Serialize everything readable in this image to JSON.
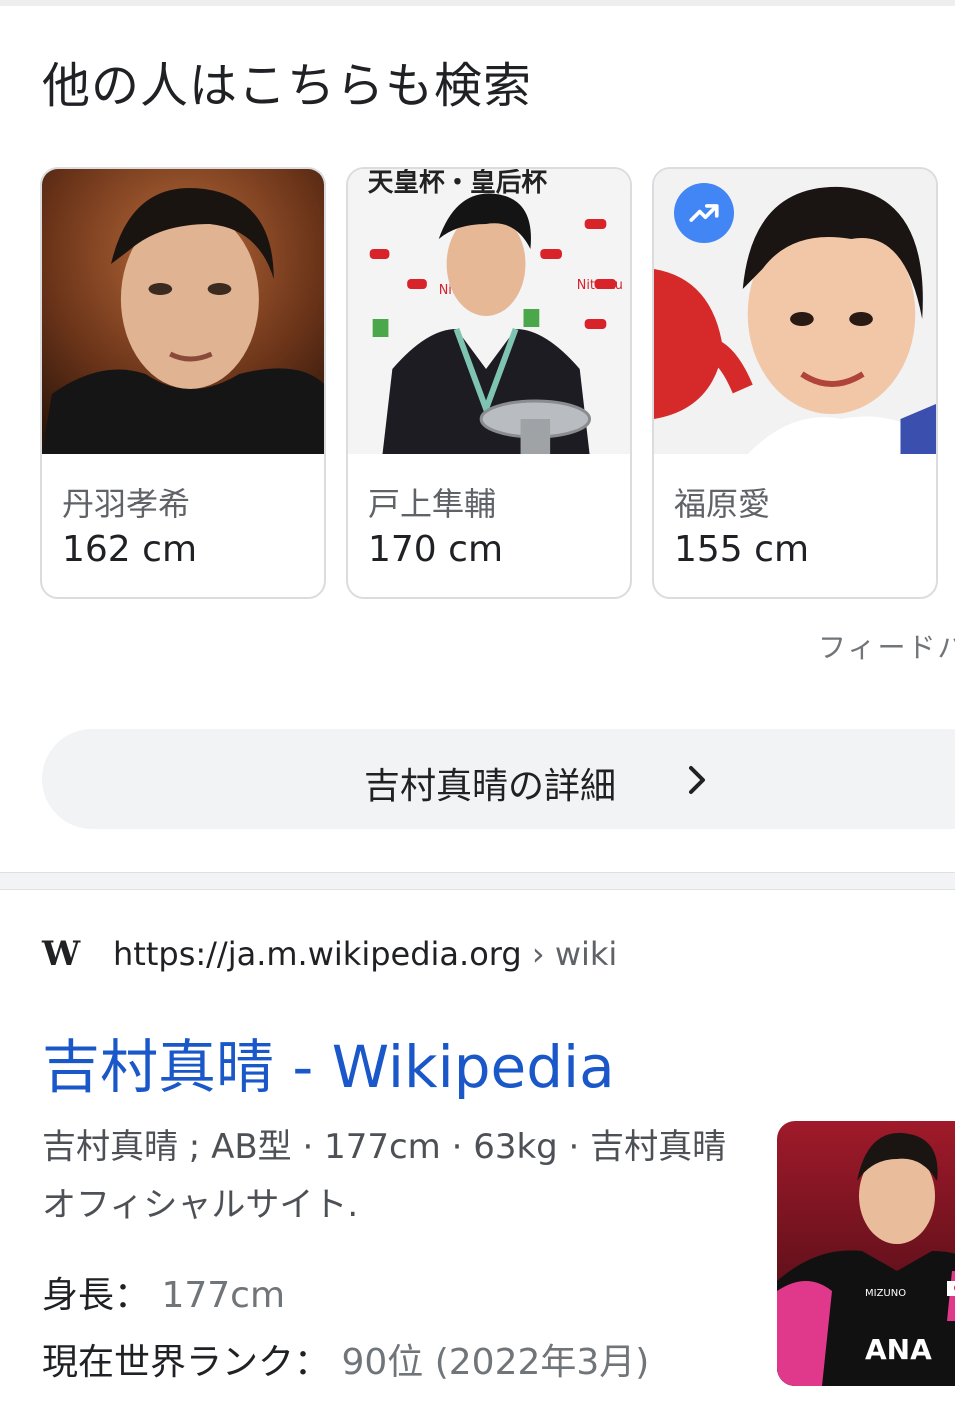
{
  "section": {
    "title": "他の人はこちらも検索"
  },
  "people": [
    {
      "name": "丹羽孝希",
      "height": "162 cm"
    },
    {
      "name": "戸上隼輔",
      "height": "170 cm"
    },
    {
      "name": "福原愛",
      "height": "155 cm"
    }
  ],
  "photo_text": {
    "banner": "天皇杯・皇后杯",
    "logo": "Nittaku",
    "sponsor": "ANA",
    "shirt_brand": "MIZUNO"
  },
  "feedback": {
    "label": "フィードバ"
  },
  "more_button": {
    "label": "吉村真晴の詳細"
  },
  "result": {
    "url_domain": "https://ja.m.wikipedia.org",
    "url_crumb": " › wiki",
    "title": "吉村真晴 - Wikipedia",
    "snippet": "吉村真晴 ; AB型 · 177cm · 63kg · 吉村真晴オフィシャルサイト.",
    "facts": [
      {
        "label": "身長：",
        "value": " 177cm"
      },
      {
        "label": "現在世界ランク：",
        "value": " 90位 (2022年3月)"
      }
    ]
  },
  "colors": {
    "link": "#1a57c9",
    "badge": "#4285f4",
    "button_bg": "#f1f3f4"
  }
}
